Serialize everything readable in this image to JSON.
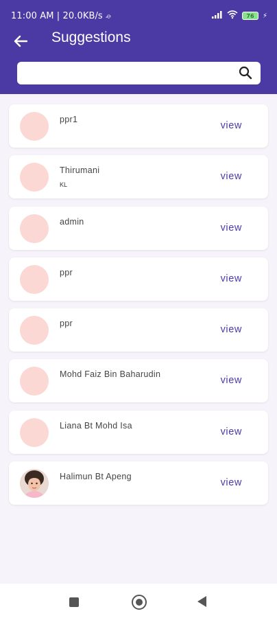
{
  "status_bar": {
    "time": "11:00 AM",
    "speed": "20.0KB/s",
    "battery": "76"
  },
  "header": {
    "title": "Suggestions",
    "background": "#4b3aa3"
  },
  "search": {
    "value": "",
    "placeholder": ""
  },
  "suggestions": [
    {
      "name": "ppr1",
      "sub": "",
      "view": "view"
    },
    {
      "name": "Thirumani",
      "sub": "KL",
      "view": "view"
    },
    {
      "name": "admin",
      "sub": "",
      "view": "view"
    },
    {
      "name": "ppr",
      "sub": "",
      "view": "view"
    },
    {
      "name": "ppr",
      "sub": "",
      "view": "view"
    },
    {
      "name": "Mohd Faiz Bin Baharudin",
      "sub": "",
      "view": "view"
    },
    {
      "name": "Liana Bt Mohd Isa",
      "sub": "",
      "view": "view"
    },
    {
      "name": "Halimun Bt Apeng",
      "sub": "",
      "view": "view"
    }
  ],
  "colors": {
    "accent": "#4b3aa3",
    "avatar_placeholder": "#fbd8d3"
  }
}
